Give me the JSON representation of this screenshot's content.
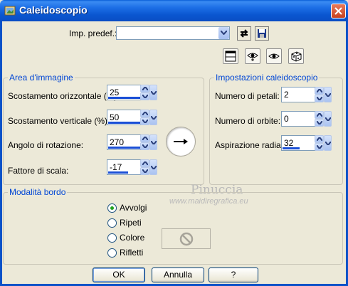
{
  "window": {
    "title": "Caleidoscopio",
    "close_icon": "close-icon"
  },
  "preset": {
    "label": "Imp. predef.:",
    "value": ""
  },
  "toolbar": {
    "icons": [
      "reset-icon",
      "save-icon",
      "preview-window-icon",
      "proof-eye-icon",
      "auto-proof-eye-icon",
      "randomize-dice-icon"
    ]
  },
  "area": {
    "legend": "Area d'immagine",
    "horizontal_offset": {
      "label": "Scostamento orizzontale (%):",
      "value": "25"
    },
    "vertical_offset": {
      "label": "Scostamento verticale (%):",
      "value": "50"
    },
    "rotation_angle": {
      "label": "Angolo di rotazione:",
      "value": "270"
    },
    "scale_factor": {
      "label": "Fattore di scala:",
      "value": "-17"
    }
  },
  "settings": {
    "legend": "Impostazioni caleidoscopio",
    "petals": {
      "label": "Numero di petali:",
      "value": "2"
    },
    "orbits": {
      "label": "Numero di orbite:",
      "value": "0"
    },
    "radial_suction": {
      "label": "Aspirazione radiale:",
      "value": "32"
    }
  },
  "edge_mode": {
    "legend": "Modalità bordo",
    "options": [
      "Avvolgi",
      "Ripeti",
      "Colore",
      "Rifletti"
    ],
    "selected": "Avvolgi"
  },
  "watermark": {
    "name": "Pinuccia",
    "url": "www.maidiregrafica.eu"
  },
  "buttons": {
    "ok": "OK",
    "cancel": "Annulla",
    "help": "?"
  },
  "colors": {
    "title_bar": "#0a56d0",
    "legend_text": "#0046d5",
    "window_bg": "#ece9d8",
    "slider_fill": "#1a4fd6"
  }
}
